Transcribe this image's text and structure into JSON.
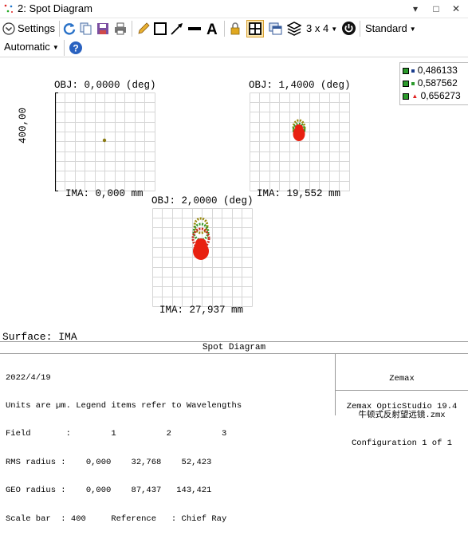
{
  "window": {
    "title": "2: Spot Diagram",
    "buttons": [
      "▾",
      "□",
      "✕"
    ]
  },
  "toolbar": {
    "settings_label": "Settings",
    "layout_label": "3 x 4",
    "style_label": "Standard",
    "zoom_label": "Automatic"
  },
  "plots": [
    {
      "obj": "OBJ: 0,0000 (deg)",
      "ima": "IMA: 0,000 mm"
    },
    {
      "obj": "OBJ: 1,4000 (deg)",
      "ima": "IMA: 19,552 mm"
    },
    {
      "obj": "OBJ: 2,0000 (deg)",
      "ima": "IMA: 27,937 mm"
    }
  ],
  "scale_label": "400,00",
  "legend": [
    {
      "value": "0,486133",
      "color": "#1a3c8c",
      "marker": "square"
    },
    {
      "value": "0,587562",
      "color": "#2c9a2c",
      "marker": "square"
    },
    {
      "value": "0,656273",
      "color": "#e02020",
      "marker": "triangle"
    }
  ],
  "surface_label": "Surface: IMA",
  "info": {
    "header": "Spot Diagram",
    "left_lines": [
      "2022/4/19",
      "Units are µm. Legend items refer to Wavelengths",
      "Field       :        1          2          3",
      "RMS radius :    0,000    32,768    52,423",
      "GEO radius :    0,000    87,437   143,421",
      "Scale bar  : 400     Reference   : Chief Ray"
    ],
    "right_top": [
      "Zemax",
      "Zemax OpticStudio 19.4"
    ],
    "right_bottom": [
      "牛顿式反射望远镜.zmx",
      "Configuration 1 of 1"
    ]
  }
}
